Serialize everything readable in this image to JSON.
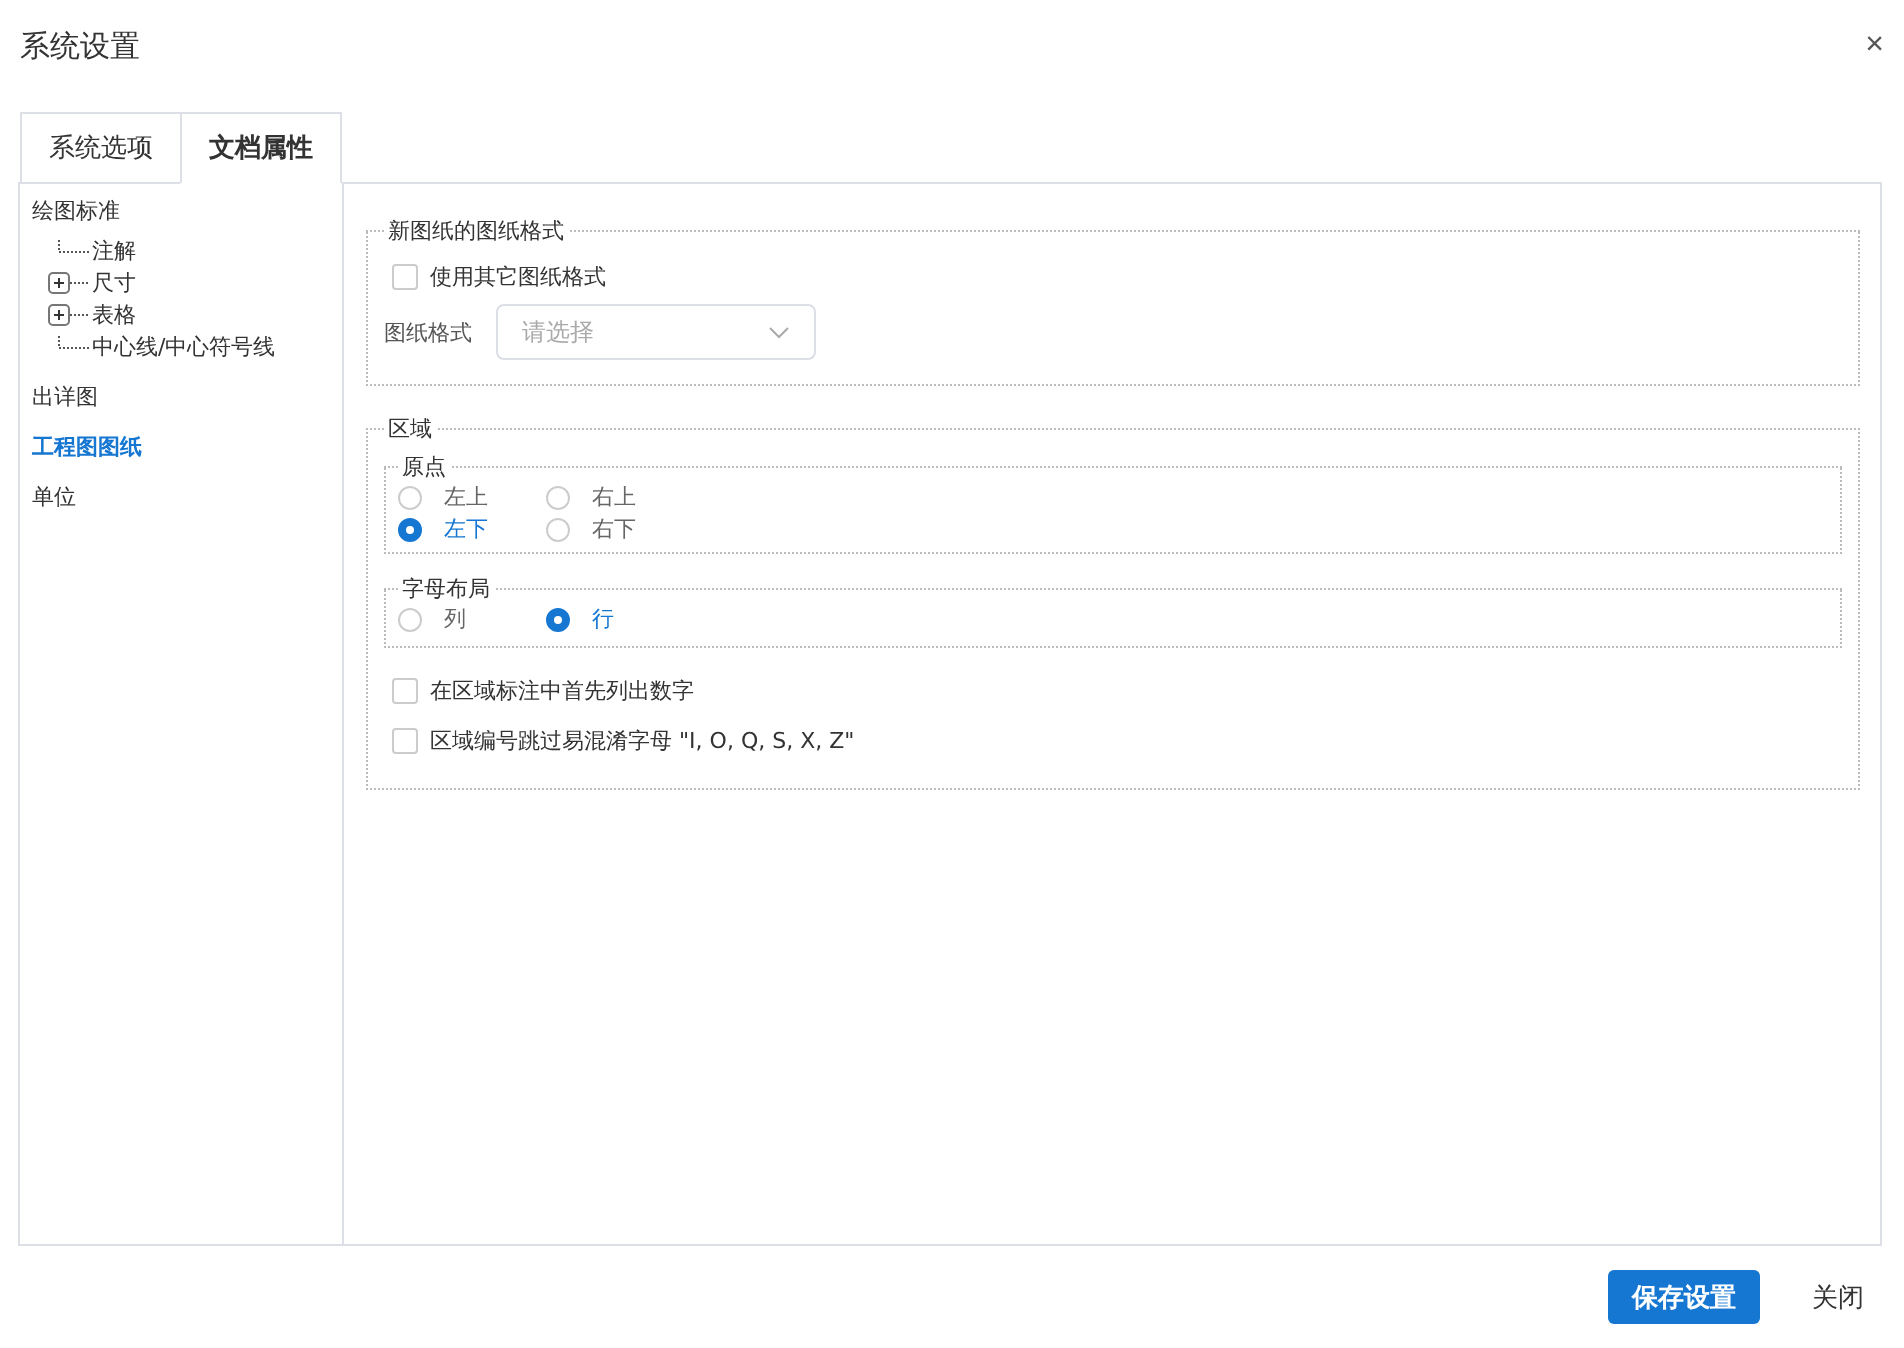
{
  "window": {
    "title": "系统设置",
    "close": "×"
  },
  "tabs": [
    {
      "label": "系统选项",
      "selected": false
    },
    {
      "label": "文档属性",
      "selected": true
    }
  ],
  "sidebar": {
    "items": [
      {
        "label": "绘图标准",
        "selected": false,
        "children": [
          {
            "label": "注解",
            "expandable": false
          },
          {
            "label": "尺寸",
            "expandable": true
          },
          {
            "label": "表格",
            "expandable": true
          },
          {
            "label": "中心线/中心符号线",
            "expandable": false
          }
        ]
      },
      {
        "label": "出详图",
        "selected": false
      },
      {
        "label": "工程图图纸",
        "selected": true
      },
      {
        "label": "单位",
        "selected": false
      }
    ]
  },
  "sheet_format": {
    "legend": "新图纸的图纸格式",
    "use_other": {
      "label": "使用其它图纸格式",
      "checked": false
    },
    "format_label": "图纸格式",
    "format_select": {
      "placeholder": "请选择"
    }
  },
  "zone": {
    "legend": "区域",
    "origin": {
      "legend": "原点",
      "options": [
        {
          "label": "左上",
          "selected": false
        },
        {
          "label": "右上",
          "selected": false
        },
        {
          "label": "左下",
          "selected": true
        },
        {
          "label": "右下",
          "selected": false
        }
      ]
    },
    "letter_layout": {
      "legend": "字母布局",
      "options": [
        {
          "label": "列",
          "selected": false
        },
        {
          "label": "行",
          "selected": true
        }
      ]
    },
    "checkboxes": [
      {
        "label": "在区域标注中首先列出数字",
        "checked": false
      },
      {
        "label": "区域编号跳过易混淆字母 \"I, O, Q, S, X, Z\"",
        "checked": false
      }
    ]
  },
  "buttons": [
    {
      "label": "保存设置",
      "kind": "primary"
    },
    {
      "label": "关闭",
      "kind": "plain"
    }
  ]
}
